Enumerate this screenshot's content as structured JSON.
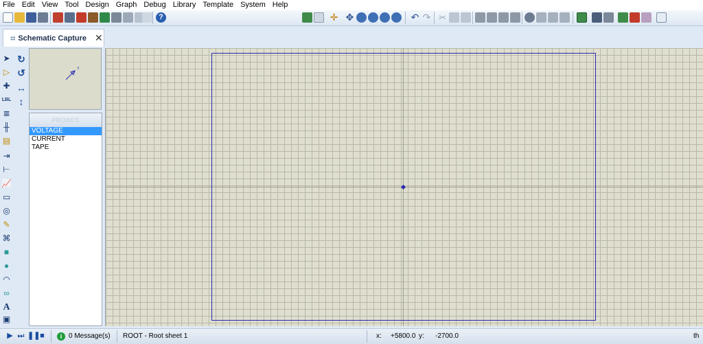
{
  "menu": [
    "File",
    "Edit",
    "View",
    "Tool",
    "Design",
    "Graph",
    "Debug",
    "Library",
    "Template",
    "System",
    "Help"
  ],
  "tab": {
    "label": "Schematic Capture",
    "icon": "schematic-icon",
    "close_glyph": "✕"
  },
  "mode_tools": [
    "selection",
    "component",
    "junction-dot",
    "wire-label",
    "text-script",
    "buses",
    "subcircuit",
    "terminals",
    "device-pins",
    "graph",
    "tape-recorder",
    "generator",
    "probe",
    "virtual-instruments",
    "line-2d",
    "box-2d",
    "circle-2d",
    "arc-2d",
    "path-2d",
    "text-2d",
    "symbols-2d",
    "markers-2d"
  ],
  "rotation_tools": [
    "rotate-clockwise",
    "rotate-anticlockwise",
    "mirror-horizontal",
    "mirror-vertical"
  ],
  "probes": {
    "header": "PROBES",
    "items": [
      "VOLTAGE",
      "CURRENT",
      "TAPE"
    ],
    "selected_index": 0
  },
  "status": {
    "messages": "0 Message(s)",
    "sheet": "ROOT - Root sheet 1",
    "x_label": "x:",
    "x_value": "+5800.0",
    "y_label": "y:",
    "y_value": "-2700.0",
    "units": "th"
  },
  "colors": {
    "canvas_bg": "#e0dfcf",
    "sheet_border": "#2727b0",
    "selection": "#3399ff"
  }
}
